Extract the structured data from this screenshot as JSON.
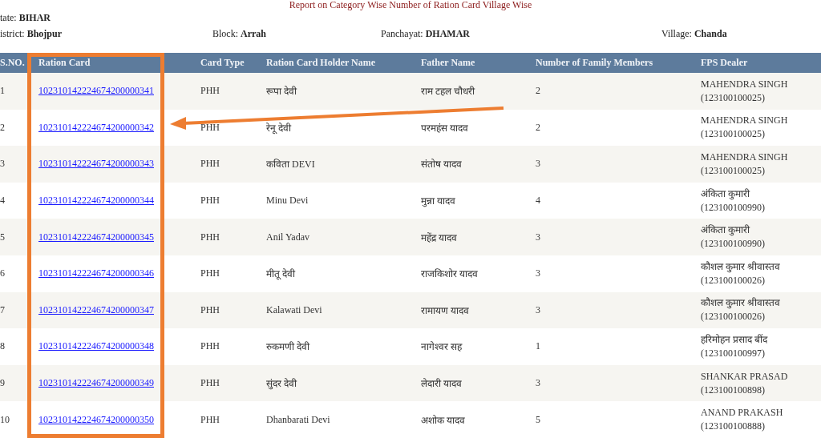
{
  "report_title": "Report on Category Wise Number of Ration Card Village Wise",
  "location": [
    {
      "label": "tate:",
      "value": "BIHAR"
    },
    {
      "label": "istrict:",
      "value": "Bhojpur"
    },
    {
      "label": "Block:",
      "value": "Arrah"
    },
    {
      "label": "Panchayat:",
      "value": "DHAMAR"
    },
    {
      "label": "Village:",
      "value": "Chanda"
    }
  ],
  "table": {
    "columns": [
      "S.NO.",
      "Ration Card",
      "Card Type",
      "Ration Card Holder Name",
      "Father Name",
      "Number of Family Members",
      "FPS Dealer"
    ],
    "rows": [
      {
        "sno": "1",
        "ration_card": "102310142224674200000341",
        "card_type": "PHH",
        "holder": "रूपा देवी",
        "father": "राम टहल चौधरी",
        "members": "2",
        "dealer": "MAHENDRA SINGH",
        "dealer_code": "(123100100025)"
      },
      {
        "sno": "2",
        "ration_card": "102310142224674200000342",
        "card_type": "PHH",
        "holder": "रेनू देवी",
        "father": "परमहंस यादव",
        "members": "2",
        "dealer": "MAHENDRA SINGH",
        "dealer_code": "(123100100025)"
      },
      {
        "sno": "3",
        "ration_card": "102310142224674200000343",
        "card_type": "PHH",
        "holder": "कविता DEVI",
        "father": "संतोष यादव",
        "members": "3",
        "dealer": "MAHENDRA SINGH",
        "dealer_code": "(123100100025)"
      },
      {
        "sno": "4",
        "ration_card": "102310142224674200000344",
        "card_type": "PHH",
        "holder": "Minu Devi",
        "father": "मुन्ना यादव",
        "members": "4",
        "dealer": "अंकिता कुमारी",
        "dealer_code": "(123100100990)"
      },
      {
        "sno": "5",
        "ration_card": "102310142224674200000345",
        "card_type": "PHH",
        "holder": "Anil Yadav",
        "father": "महेंद्र यादव",
        "members": "3",
        "dealer": "अंकिता कुमारी",
        "dealer_code": "(123100100990)"
      },
      {
        "sno": "6",
        "ration_card": "102310142224674200000346",
        "card_type": "PHH",
        "holder": "मीतू देवी",
        "father": "राजकिशोर यादव",
        "members": "3",
        "dealer": "कौशल कुमार श्रीवास्तव",
        "dealer_code": "(123100100026)"
      },
      {
        "sno": "7",
        "ration_card": "102310142224674200000347",
        "card_type": "PHH",
        "holder": "Kalawati Devi",
        "father": "रामायण यादव",
        "members": "3",
        "dealer": "कौशल कुमार श्रीवास्तव",
        "dealer_code": "(123100100026)"
      },
      {
        "sno": "8",
        "ration_card": "102310142224674200000348",
        "card_type": "PHH",
        "holder": "रुकमणी देवी",
        "father": "नागेश्वर सह",
        "members": "1",
        "dealer": "हरिमोहन प्रसाद बींद",
        "dealer_code": "(123100100997)"
      },
      {
        "sno": "9",
        "ration_card": "102310142224674200000349",
        "card_type": "PHH",
        "holder": "सुंदर देवी",
        "father": "लेदारी यादव",
        "members": "3",
        "dealer": "SHANKAR PRASAD",
        "dealer_code": "(123100100898)"
      },
      {
        "sno": "10",
        "ration_card": "102310142224674200000350",
        "card_type": "PHH",
        "holder": "Dhanbarati Devi",
        "father": "अशोक यादव",
        "members": "5",
        "dealer": "ANAND PRAKASH",
        "dealer_code": "(123100100888)"
      }
    ]
  }
}
